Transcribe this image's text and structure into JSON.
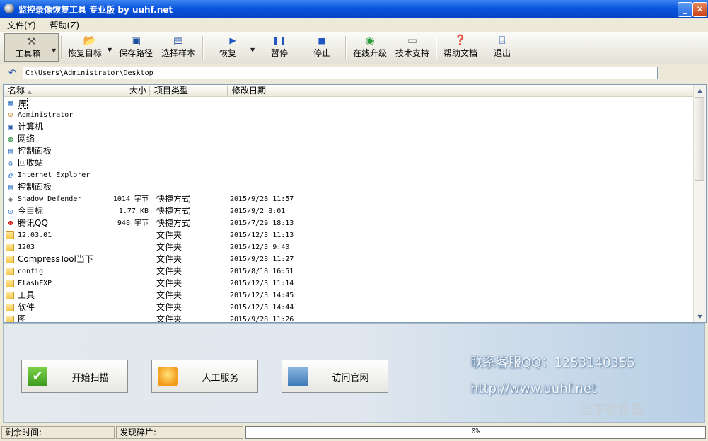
{
  "window": {
    "title": "监控录像恢复工具 专业版 by uuhf.net"
  },
  "menu": [
    {
      "label": "文件(Y)"
    },
    {
      "label": "帮助(Z)"
    }
  ],
  "toolbar": {
    "toolbox": "工具箱",
    "recover_target": "恢复目标",
    "save_path": "保存路径",
    "select_sample": "选择样本",
    "recover": "恢复",
    "pause": "暂停",
    "stop": "停止",
    "online_upgrade": "在线升级",
    "tech_support": "技术支持",
    "help_doc": "帮助文档",
    "exit": "退出"
  },
  "address": {
    "path": "C:\\Users\\Administrator\\Desktop"
  },
  "columns": {
    "name": "名称",
    "size": "大小",
    "type": "项目类型",
    "modified": "修改日期"
  },
  "files": [
    {
      "icon": "library-icon",
      "name": "库",
      "size": "",
      "type": "",
      "date": ""
    },
    {
      "icon": "user-folder-icon",
      "name": "Administrator",
      "size": "",
      "type": "",
      "date": ""
    },
    {
      "icon": "computer-icon",
      "name": "计算机",
      "size": "",
      "type": "",
      "date": ""
    },
    {
      "icon": "network-icon",
      "name": "网络",
      "size": "",
      "type": "",
      "date": ""
    },
    {
      "icon": "control-panel-icon",
      "name": "控制面板",
      "size": "",
      "type": "",
      "date": ""
    },
    {
      "icon": "recycle-bin-icon",
      "name": "回收站",
      "size": "",
      "type": "",
      "date": ""
    },
    {
      "icon": "internet-explorer-icon",
      "name": "Internet Explorer",
      "size": "",
      "type": "",
      "date": ""
    },
    {
      "icon": "control-panel-icon",
      "name": "控制面板",
      "size": "",
      "type": "",
      "date": ""
    },
    {
      "icon": "shadow-defender-icon",
      "name": "Shadow Defender",
      "size": "1014 字节",
      "type": "快捷方式",
      "date": "2015/9/28 11:57"
    },
    {
      "icon": "target-shortcut-icon",
      "name": "今目标",
      "size": "1.77 KB",
      "type": "快捷方式",
      "date": "2015/9/2 8:01"
    },
    {
      "icon": "qq-icon",
      "name": "腾讯QQ",
      "size": "948 字节",
      "type": "快捷方式",
      "date": "2015/7/29 18:13"
    },
    {
      "icon": "folder-icon",
      "name": "12.03.01",
      "size": "",
      "type": "文件夹",
      "date": "2015/12/3 11:13"
    },
    {
      "icon": "folder-icon",
      "name": "1203",
      "size": "",
      "type": "文件夹",
      "date": "2015/12/3 9:40"
    },
    {
      "icon": "folder-icon",
      "name": "CompressTool当下",
      "size": "",
      "type": "文件夹",
      "date": "2015/9/28 11:27"
    },
    {
      "icon": "folder-icon",
      "name": "config",
      "size": "",
      "type": "文件夹",
      "date": "2015/8/18 16:51"
    },
    {
      "icon": "folder-icon",
      "name": "FlashFXP",
      "size": "",
      "type": "文件夹",
      "date": "2015/12/3 11:14"
    },
    {
      "icon": "folder-icon",
      "name": "工具",
      "size": "",
      "type": "文件夹",
      "date": "2015/12/3 14:45"
    },
    {
      "icon": "folder-icon",
      "name": "软件",
      "size": "",
      "type": "文件夹",
      "date": "2015/12/3 14:44"
    },
    {
      "icon": "folder-icon",
      "name": "图",
      "size": "",
      "type": "文件夹",
      "date": "2015/9/28 11:26"
    }
  ],
  "actions": {
    "start_scan": "开始扫描",
    "manual_service": "人工服务",
    "visit_site": "访问官网"
  },
  "contact": {
    "qq": "联系客服QQ：1253140355",
    "url": "http://www.uuhf.net"
  },
  "watermark": "当下软件园",
  "status": {
    "remaining_time_label": "剩余时间:",
    "fragments_label": "发现碎片:",
    "progress_text": "0%",
    "progress_value": 0
  },
  "colors": {
    "title_bar": "#0a55dd",
    "accent": "#3b8be0",
    "contact_text": "#f2f6fb"
  }
}
